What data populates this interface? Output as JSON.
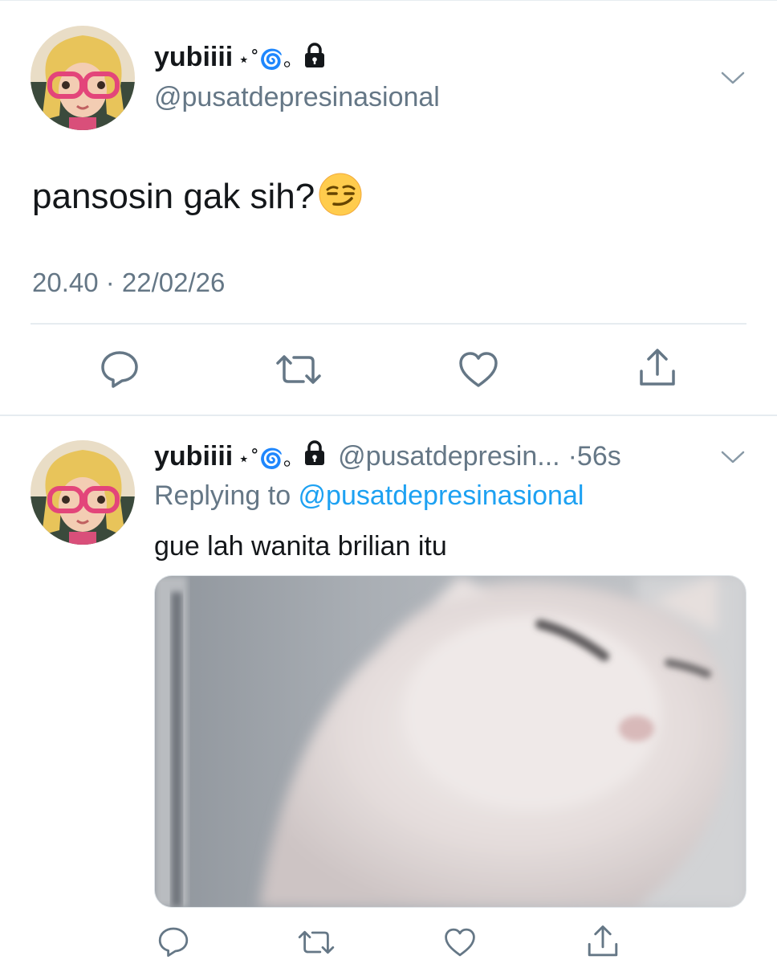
{
  "main_tweet": {
    "display_name": "yubiiii",
    "name_decoration": "⋆˚🌀｡",
    "handle": "@pusatdepresinasional",
    "text": "pansosin gak sih?",
    "timestamp": "20.40 · 22/02/26"
  },
  "reply_tweet": {
    "display_name": "yubiiii",
    "name_decoration": "⋆˚🌀｡",
    "handle": "@pusatdepresin...",
    "time": "·56s",
    "replying_prefix": "Replying to ",
    "replying_mention": "@pusatdepresinasional",
    "text": "gue lah wanita brilian itu"
  },
  "icons": {
    "reply": "reply-icon",
    "retweet": "retweet-icon",
    "like": "heart-icon",
    "share": "share-icon",
    "lock": "lock-icon",
    "caret": "chevron-down-icon"
  },
  "colors": {
    "text": "#14171a",
    "secondary": "#657786",
    "link": "#1da1f2",
    "divider": "#e6ecf0"
  }
}
